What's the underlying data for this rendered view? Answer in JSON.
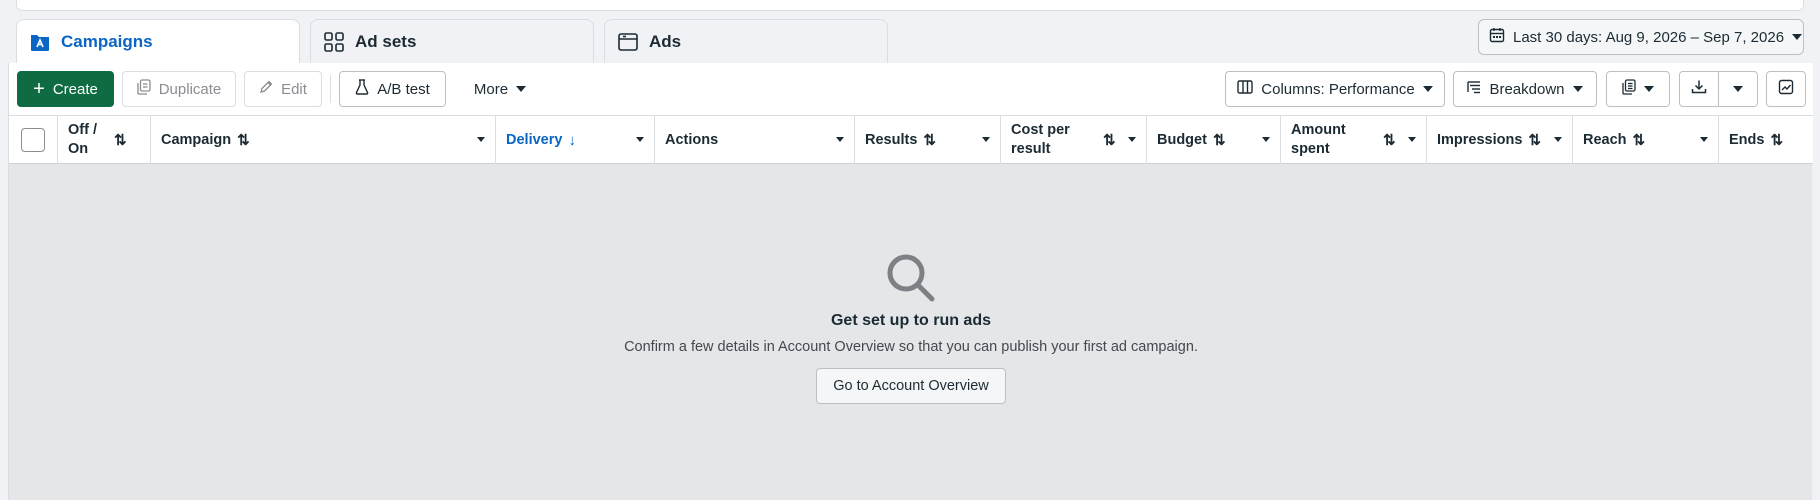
{
  "tabs": [
    {
      "label": "Campaigns",
      "icon": "campaign-folder-icon",
      "active": true
    },
    {
      "label": "Ad sets",
      "icon": "grid-icon",
      "active": false
    },
    {
      "label": "Ads",
      "icon": "ad-window-icon",
      "active": false
    }
  ],
  "date_range": {
    "label": "Last 30 days: Aug 9, 2026 – Sep 7, 2026"
  },
  "toolbar": {
    "create_label": "Create",
    "duplicate_label": "Duplicate",
    "edit_label": "Edit",
    "ab_test_label": "A/B test",
    "more_label": "More",
    "columns_label": "Columns: Performance",
    "breakdown_label": "Breakdown"
  },
  "columns": [
    {
      "label": "Off / On",
      "sortable": true
    },
    {
      "label": "Campaign",
      "sortable": true
    },
    {
      "label": "Delivery",
      "sorted": "desc"
    },
    {
      "label": "Actions"
    },
    {
      "label": "Results",
      "sortable": true
    },
    {
      "label": "Cost per result",
      "sortable": true
    },
    {
      "label": "Budget",
      "sortable": true
    },
    {
      "label": "Amount spent",
      "sortable": true
    },
    {
      "label": "Impressions",
      "sortable": true
    },
    {
      "label": "Reach",
      "sortable": true
    },
    {
      "label": "Ends",
      "sortable": true
    }
  ],
  "empty_state": {
    "title": "Get set up to run ads",
    "description": "Confirm a few details in Account Overview so that you can publish your first ad campaign.",
    "button_label": "Go to Account Overview"
  },
  "colors": {
    "accent_blue": "#0a66c2",
    "create_green": "#0e6b42",
    "panel_bg": "#e4e6e8"
  }
}
